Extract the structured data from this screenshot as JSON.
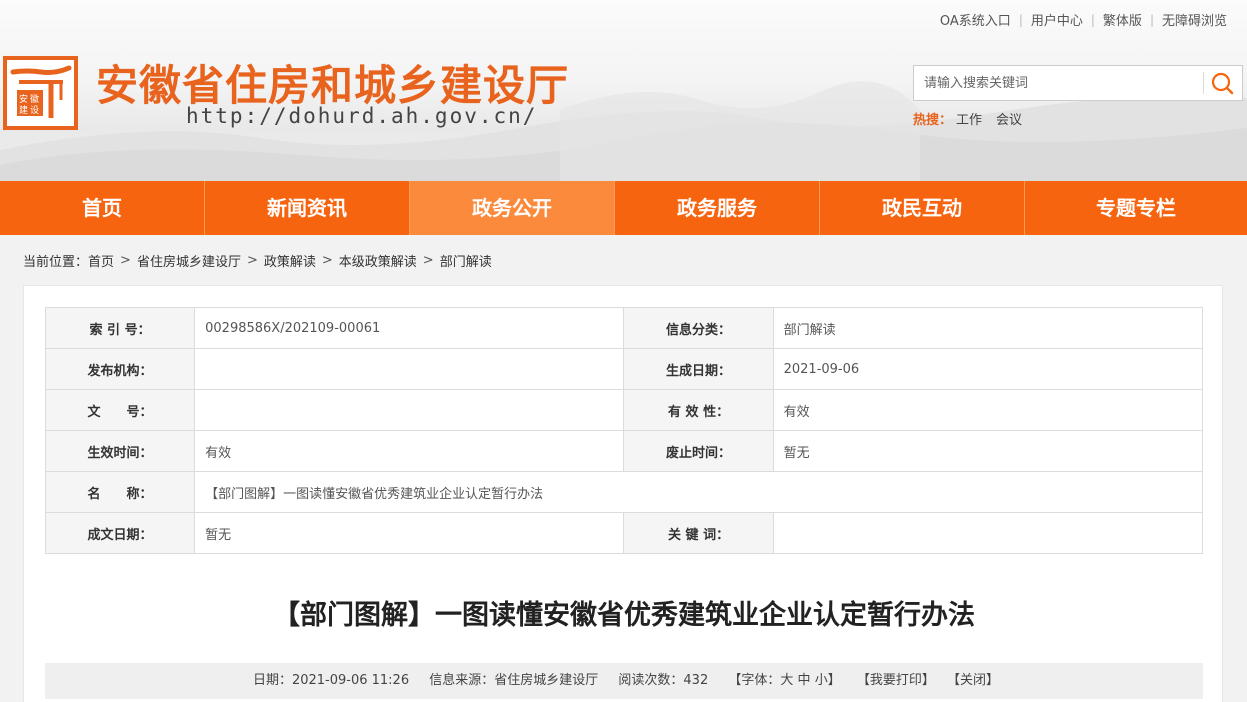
{
  "top_links": [
    "OA系统入口",
    "用户中心",
    "繁体版",
    "无障碍浏览"
  ],
  "site": {
    "title": "安徽省住房和城乡建设厅",
    "url": "http://dohurd.ah.gov.cn/"
  },
  "search": {
    "placeholder": "请输入搜索关键词",
    "hot_label": "热搜：",
    "hot_terms": [
      "工作",
      "会议"
    ]
  },
  "nav": {
    "items": [
      "首页",
      "新闻资讯",
      "政务公开",
      "政务服务",
      "政民互动",
      "专题专栏"
    ],
    "active": "政务公开"
  },
  "breadcrumb": {
    "label": "当前位置：",
    "items": [
      "首页",
      "省住房城乡建设厅",
      "政策解读",
      "本级政策解读",
      "部门解读"
    ]
  },
  "meta": {
    "rows": [
      [
        {
          "label": "索 引 号：",
          "value": "00298586X/202109-00061"
        },
        {
          "label": "信息分类：",
          "value": "部门解读"
        }
      ],
      [
        {
          "label": "发布机构：",
          "value": ""
        },
        {
          "label": "生成日期：",
          "value": "2021-09-06"
        }
      ],
      [
        {
          "label": "文　　号：",
          "value": ""
        },
        {
          "label": "有 效 性：",
          "value": "有效"
        }
      ],
      [
        {
          "label": "生效时间：",
          "value": "有效"
        },
        {
          "label": "废止时间：",
          "value": "暂无"
        }
      ],
      [
        {
          "label": "名　　称：",
          "value": "【部门图解】一图读懂安徽省优秀建筑业企业认定暂行办法"
        }
      ],
      [
        {
          "label": "成文日期：",
          "value": "暂无"
        },
        {
          "label": "关 键 词：",
          "value": ""
        }
      ]
    ]
  },
  "article": {
    "title": "【部门图解】一图读懂安徽省优秀建筑业企业认定暂行办法",
    "date": "日期：2021-09-06 11:26",
    "source": "信息来源：省住房城乡建设厅",
    "reads": "阅读次数：432",
    "font_prefix": "【字体：",
    "font_sizes": [
      "大",
      "中",
      "小"
    ],
    "font_suffix": "】",
    "print": "【我要打印】",
    "close": "【关闭】"
  },
  "colors": {
    "brand_orange": "#f7640f",
    "nav_active": "#fb8a3c",
    "title_orange": "#e8641e"
  },
  "icons": {
    "search": "search-icon",
    "logo": "emblem-logo"
  }
}
